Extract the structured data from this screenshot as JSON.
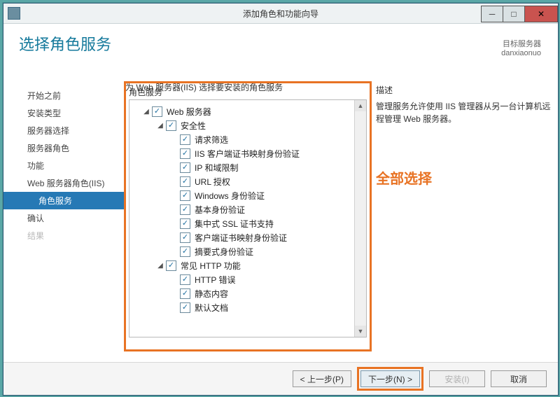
{
  "window": {
    "title": "添加角色和功能向导",
    "minimize": "─",
    "maximize": "□",
    "close": "✕"
  },
  "header": {
    "title": "选择角色服务",
    "target_label": "目标服务器",
    "target_value": "danxiaonuo"
  },
  "sidebar": {
    "steps": [
      {
        "label": "开始之前"
      },
      {
        "label": "安装类型"
      },
      {
        "label": "服务器选择"
      },
      {
        "label": "服务器角色"
      },
      {
        "label": "功能"
      },
      {
        "label": "Web 服务器角色(IIS)"
      },
      {
        "label": "角色服务",
        "sub": true,
        "selected": true
      },
      {
        "label": "确认"
      },
      {
        "label": "结果",
        "disabled": true
      }
    ]
  },
  "main": {
    "topnote": "为 Web 服务器(IIS) 选择要安装的角色服务",
    "panel_label": "角色服务",
    "tree": [
      {
        "level": 1,
        "exp": "▢",
        "label": "Web 服务器"
      },
      {
        "level": 2,
        "exp": "▢",
        "label": "安全性"
      },
      {
        "level": 3,
        "label": "请求筛选"
      },
      {
        "level": 3,
        "label": "IIS 客户端证书映射身份验证"
      },
      {
        "level": 3,
        "label": "IP 和域限制"
      },
      {
        "level": 3,
        "label": "URL 授权"
      },
      {
        "level": 3,
        "label": "Windows 身份验证"
      },
      {
        "level": 3,
        "label": "基本身份验证"
      },
      {
        "level": 3,
        "label": "集中式 SSL 证书支持"
      },
      {
        "level": 3,
        "label": "客户端证书映射身份验证"
      },
      {
        "level": 3,
        "label": "摘要式身份验证"
      },
      {
        "level": 2,
        "exp": "▢",
        "label": "常见 HTTP 功能"
      },
      {
        "level": 3,
        "label": "HTTP 错误"
      },
      {
        "level": 3,
        "label": "静态内容"
      },
      {
        "level": 3,
        "label": "默认文档"
      }
    ]
  },
  "right": {
    "desc_heading": "描述",
    "desc_text": "管理服务允许使用 IIS 管理器从另一台计算机远程管理 Web 服务器。",
    "annotation": "全部选择"
  },
  "footer": {
    "prev": "< 上一步(P)",
    "next": "下一步(N) >",
    "install": "安装(I)",
    "cancel": "取消"
  }
}
